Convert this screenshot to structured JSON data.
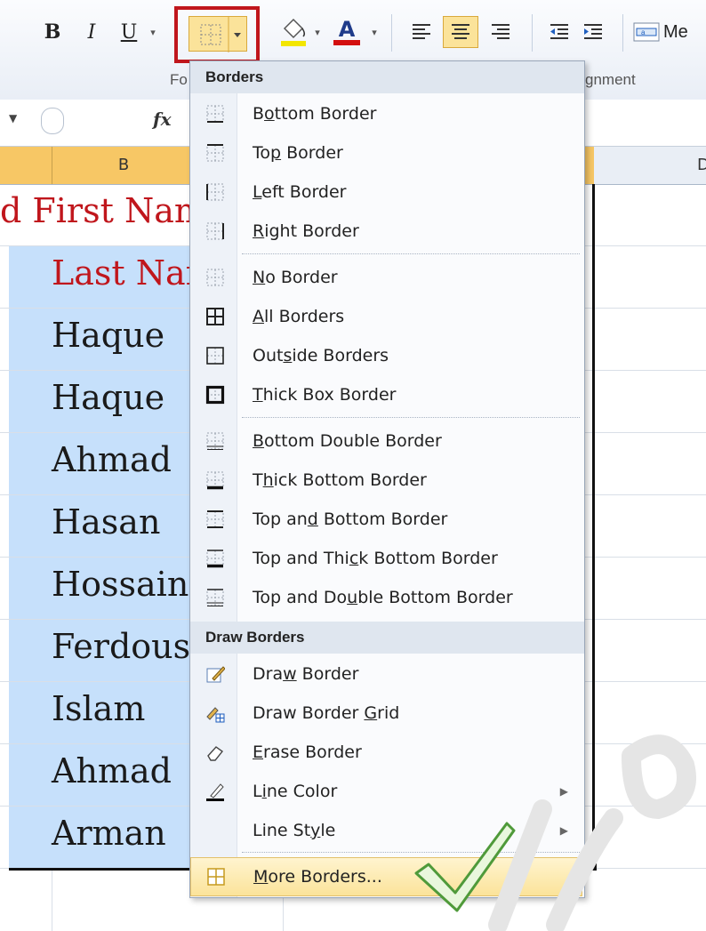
{
  "ribbon": {
    "bold": "B",
    "italic": "I",
    "underline": "U",
    "font_color_letter": "A",
    "merge_label": "Me",
    "group_font": "Fo",
    "group_alignment": "gnment"
  },
  "formula_bar": {
    "fx": "fx"
  },
  "columns": {
    "b": "B",
    "d": "D"
  },
  "cells": [
    "d First Nam",
    "Last Nar",
    "Haque",
    "Haque",
    "Ahmad",
    "Hasan",
    "Hossain",
    "Ferdous",
    "Islam",
    "Ahmad",
    "Arman"
  ],
  "menu": {
    "borders_header": "Borders",
    "items": [
      {
        "pre": "B",
        "u": "o",
        "post": "ttom Border",
        "icon": "bottom-border-icon"
      },
      {
        "pre": "To",
        "u": "p",
        "post": " Border",
        "icon": "top-border-icon"
      },
      {
        "pre": "",
        "u": "L",
        "post": "eft Border",
        "icon": "left-border-icon"
      },
      {
        "pre": "",
        "u": "R",
        "post": "ight Border",
        "icon": "right-border-icon"
      },
      {
        "pre": "",
        "u": "N",
        "post": "o Border",
        "icon": "no-border-icon"
      },
      {
        "pre": "",
        "u": "A",
        "post": "ll Borders",
        "icon": "all-borders-icon"
      },
      {
        "pre": "Out",
        "u": "s",
        "post": "ide Borders",
        "icon": "outside-borders-icon"
      },
      {
        "pre": "",
        "u": "T",
        "post": "hick Box Border",
        "icon": "thick-box-border-icon"
      },
      {
        "pre": "",
        "u": "B",
        "post": "ottom Double Border",
        "icon": "bottom-double-border-icon"
      },
      {
        "pre": "T",
        "u": "h",
        "post": "ick Bottom Border",
        "icon": "thick-bottom-border-icon"
      },
      {
        "pre": "Top an",
        "u": "d",
        "post": " Bottom Border",
        "icon": "top-bottom-border-icon"
      },
      {
        "pre": "Top and Thi",
        "u": "c",
        "post": "k Bottom Border",
        "icon": "top-thick-bottom-border-icon"
      },
      {
        "pre": "Top and Do",
        "u": "u",
        "post": "ble Bottom Border",
        "icon": "top-double-bottom-border-icon"
      }
    ],
    "draw_header": "Draw Borders",
    "draw_items": [
      {
        "pre": "Dra",
        "u": "w",
        "post": " Border",
        "icon": "draw-border-pencil-icon"
      },
      {
        "pre": "Draw Border ",
        "u": "G",
        "post": "rid",
        "icon": "draw-border-grid-icon"
      },
      {
        "pre": "",
        "u": "E",
        "post": "rase Border",
        "icon": "eraser-icon"
      },
      {
        "pre": "L",
        "u": "i",
        "post": "ne Color",
        "icon": "line-color-icon"
      },
      {
        "pre": "Line St",
        "u": "y",
        "post": "le",
        "icon": "line-style-icon"
      }
    ],
    "more": {
      "pre": "",
      "u": "M",
      "post": "ore Borders...",
      "icon": "more-borders-icon"
    }
  },
  "colors": {
    "highlight": "#fbe39a",
    "callout": "#c0161c",
    "header_red": "#c0161c",
    "selection": "#c6e0fb"
  }
}
